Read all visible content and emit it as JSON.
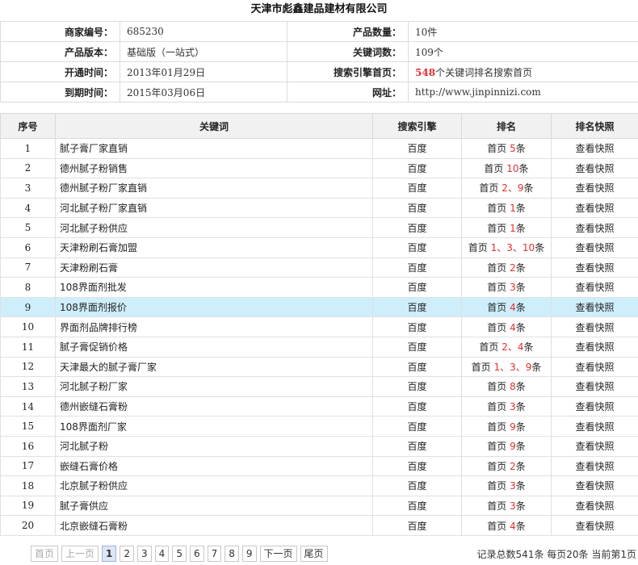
{
  "title": "天津市彪鑫建品建材有限公司",
  "info": {
    "merchant_id_label": "商家编号：",
    "merchant_id": "685230",
    "product_count_label": "产品数量：",
    "product_count": "10件",
    "version_label": "产品版本：",
    "version": "基础版（一站式）",
    "keyword_count_label": "关键词数：",
    "keyword_count": "109个",
    "open_time_label": "开通时间：",
    "open_time": "2013年01月29日",
    "engine_home_label": "搜索引擎首页：",
    "engine_home_num": "548",
    "engine_home_text": "个关键词排名搜索首页",
    "expire_label": "到期时间：",
    "expire_time": "2015年03月06日",
    "website_label": "网址：",
    "website": "http://www.jinpinnizi.com"
  },
  "table": {
    "headers": [
      "序号",
      "关键词",
      "搜索引擎",
      "排名",
      "排名快照"
    ],
    "rows": [
      {
        "no": "1",
        "keyword": "腻子膏厂家直销",
        "engine": "百度",
        "rank_prefix": "首页",
        "rank_nums": "5",
        "rank_suffix": "条",
        "snapshot": "查看快照"
      },
      {
        "no": "2",
        "keyword": "德州腻子粉销售",
        "engine": "百度",
        "rank_prefix": "首页",
        "rank_nums": "10",
        "rank_suffix": "条",
        "snapshot": "查看快照"
      },
      {
        "no": "3",
        "keyword": "德州腻子粉厂家直销",
        "engine": "百度",
        "rank_prefix": "首页",
        "rank_nums": "2、9",
        "rank_suffix": "条",
        "snapshot": "查看快照"
      },
      {
        "no": "4",
        "keyword": "河北腻子粉厂家直销",
        "engine": "百度",
        "rank_prefix": "首页",
        "rank_nums": "1",
        "rank_suffix": "条",
        "snapshot": "查看快照"
      },
      {
        "no": "5",
        "keyword": "河北腻子粉供应",
        "engine": "百度",
        "rank_prefix": "首页",
        "rank_nums": "1",
        "rank_suffix": "条",
        "snapshot": "查看快照"
      },
      {
        "no": "6",
        "keyword": "天津粉刷石膏加盟",
        "engine": "百度",
        "rank_prefix": "首页",
        "rank_nums": "1、3、10",
        "rank_suffix": "条",
        "snapshot": "查看快照"
      },
      {
        "no": "7",
        "keyword": "天津粉刷石膏",
        "engine": "百度",
        "rank_prefix": "首页",
        "rank_nums": "2",
        "rank_suffix": "条",
        "snapshot": "查看快照"
      },
      {
        "no": "8",
        "keyword": "108界面剂批发",
        "engine": "百度",
        "rank_prefix": "首页",
        "rank_nums": "3",
        "rank_suffix": "条",
        "snapshot": "查看快照"
      },
      {
        "no": "9",
        "keyword": "108界面剂报价",
        "engine": "百度",
        "rank_prefix": "首页",
        "rank_nums": "4",
        "rank_suffix": "条",
        "snapshot": "查看快照",
        "highlight": true
      },
      {
        "no": "10",
        "keyword": "界面剂品牌排行榜",
        "engine": "百度",
        "rank_prefix": "首页",
        "rank_nums": "4",
        "rank_suffix": "条",
        "snapshot": "查看快照"
      },
      {
        "no": "11",
        "keyword": "腻子膏促销价格",
        "engine": "百度",
        "rank_prefix": "首页",
        "rank_nums": "2、4",
        "rank_suffix": "条",
        "snapshot": "查看快照"
      },
      {
        "no": "12",
        "keyword": "天津最大的腻子膏厂家",
        "engine": "百度",
        "rank_prefix": "首页",
        "rank_nums": "1、3、9",
        "rank_suffix": "条",
        "snapshot": "查看快照"
      },
      {
        "no": "13",
        "keyword": "河北腻子粉厂家",
        "engine": "百度",
        "rank_prefix": "首页",
        "rank_nums": "8",
        "rank_suffix": "条",
        "snapshot": "查看快照"
      },
      {
        "no": "14",
        "keyword": "德州嵌缝石膏粉",
        "engine": "百度",
        "rank_prefix": "首页",
        "rank_nums": "3",
        "rank_suffix": "条",
        "snapshot": "查看快照"
      },
      {
        "no": "15",
        "keyword": "108界面剂厂家",
        "engine": "百度",
        "rank_prefix": "首页",
        "rank_nums": "9",
        "rank_suffix": "条",
        "snapshot": "查看快照"
      },
      {
        "no": "16",
        "keyword": "河北腻子粉",
        "engine": "百度",
        "rank_prefix": "首页",
        "rank_nums": "9",
        "rank_suffix": "条",
        "snapshot": "查看快照"
      },
      {
        "no": "17",
        "keyword": "嵌缝石膏价格",
        "engine": "百度",
        "rank_prefix": "首页",
        "rank_nums": "2",
        "rank_suffix": "条",
        "snapshot": "查看快照"
      },
      {
        "no": "18",
        "keyword": "北京腻子粉供应",
        "engine": "百度",
        "rank_prefix": "首页",
        "rank_nums": "3",
        "rank_suffix": "条",
        "snapshot": "查看快照"
      },
      {
        "no": "19",
        "keyword": "腻子膏供应",
        "engine": "百度",
        "rank_prefix": "首页",
        "rank_nums": "3",
        "rank_suffix": "条",
        "snapshot": "查看快照"
      },
      {
        "no": "20",
        "keyword": "北京嵌缝石膏粉",
        "engine": "百度",
        "rank_prefix": "首页",
        "rank_nums": "4",
        "rank_suffix": "条",
        "snapshot": "查看快照"
      }
    ]
  },
  "pager": {
    "first": "首页",
    "prev": "上一页",
    "pages": [
      "1",
      "2",
      "3",
      "4",
      "5",
      "6",
      "7",
      "8",
      "9"
    ],
    "current": "1",
    "next": "下一页",
    "last": "尾页",
    "stats": "记录总数541条 每页20条 当前第1页"
  }
}
